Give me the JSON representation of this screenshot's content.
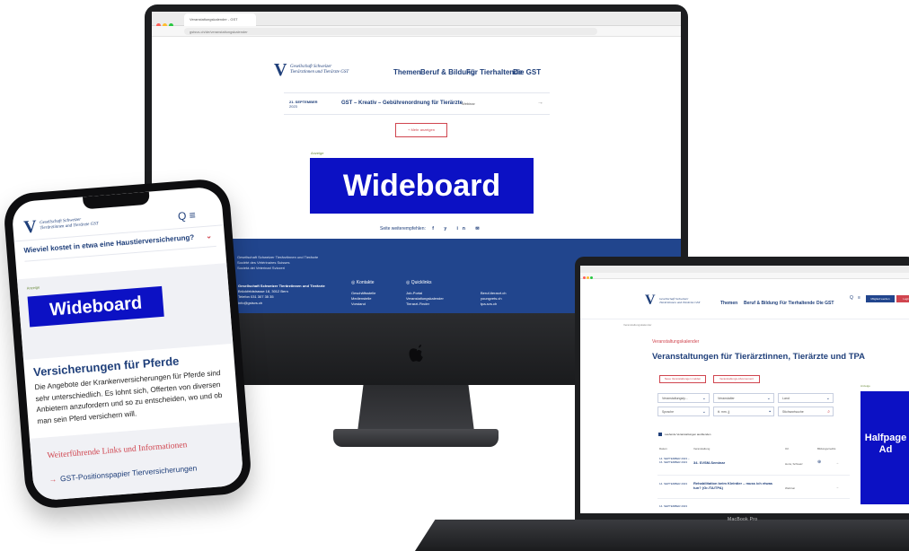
{
  "colors": {
    "brand": "#1f3f7a",
    "accent": "#d0454f",
    "ad": "#0c11c4",
    "footer": "#21458d"
  },
  "imac": {
    "browser": {
      "tab_title": "Veranstaltungskalender - GST",
      "url": "gstsvs.ch/de/veranstaltungskalender"
    },
    "logo": {
      "mark": "V",
      "line1": "Gesellschaft Schweizer",
      "line2": "Tierärztinnen und Tierärzte GST"
    },
    "nav": [
      "Themen",
      "Beruf & Bildung",
      "Für Tierhaltende",
      "Die GST"
    ],
    "event": {
      "date": "21. SEPTEMBER",
      "date_sub": "2023",
      "title": "GST – Kreativ – Gebührenordnung für Tierärzte",
      "type": "Webinar",
      "arrow": "→"
    },
    "more_button": "+ Mehr anzeigen",
    "ad_label": "Anzeige",
    "wideboard": "Wideboard",
    "share_label": "Seite weiterempfehlen:",
    "share_icons": "f y in ✉",
    "footer": {
      "logo_mark": "V",
      "text": [
        "Gesellschaft Schweizer Tierärztinnen und Tierärzte",
        "Société des Vétérinaires Suisses",
        "Società dei Veterinari Svizzeri"
      ],
      "address": {
        "heading": "Gesellschaft Schweizer Tierärztinnen und Tierärzte",
        "lines": [
          "Brückfeldstrasse 18, 3012 Bern",
          "Telefon 031 307 35 35",
          "info@gstsvs.ch"
        ]
      },
      "kontakte": {
        "heading": "◎ Kontakte",
        "items": [
          "Geschäftsstelle",
          "Medienstelle",
          "Vorstand"
        ]
      },
      "quicklinks": {
        "heading": "◎ Quicklinks",
        "items": [
          "Job-Portal",
          "Veranstaltungskalender",
          "Tierarzt-Finder"
        ]
      },
      "links": [
        "Beruf-tierarzt.ch",
        "youngvets.ch",
        "tpa-svs.ch"
      ]
    }
  },
  "phone": {
    "logo": {
      "mark": "V",
      "line1": "Gesellschaft Schweizer",
      "line2": "Tierärztinnen und Tierärzte GST"
    },
    "header_icons": "Q ≡",
    "faq": "Wieviel kostet in etwa eine Haustierversicherung?",
    "faq_chevron": "⌄",
    "ad_label": "Anzeige",
    "wideboard": "Wideboard",
    "heading": "Versicherungen für Pferde",
    "body": "Die Angebote der Krankenversicherungen für Pferde sind sehr unterschiedlich. Es lohnt sich, Offerten von diversen Anbietern anzufordern und so zu entscheiden, wo und ob man sein Pferd versichern will.",
    "links_title": "Weiterführende Links und Informationen",
    "link_arrow": "→",
    "link": "GST-Positionspapier Tierversicherungen"
  },
  "laptop": {
    "logo": {
      "mark": "V",
      "line1": "Gesellschaft Schweizer",
      "line2": "Tierärztinnen und Tierärzte GST"
    },
    "nav": [
      "Themen",
      "Beruf & Bildung",
      "Für Tierhaltende",
      "Die GST"
    ],
    "top_buttons": [
      "Mitglied werden",
      "Login"
    ],
    "breadcrumb": "Veranstaltungskalender",
    "kicker": "Veranstaltungskalender",
    "title": "Veranstaltungen für Tierärztinnen, Tierärzte und TPA",
    "buttons": [
      "Neue Veranstaltungen melden",
      "Veranstaltungs-Abonnement"
    ],
    "filters": {
      "type": "Veranstaltungsty...",
      "organizer": "Veranstalter",
      "place": "Land",
      "language": "Sprache",
      "date": "tt. mm. jj",
      "search": "Stichwortsuche"
    },
    "checkbox": "Laufende Veranstaltungen ausblenden",
    "columns": [
      "Datum",
      "Veranstaltung",
      "Ort",
      "Bildungscredits"
    ],
    "rows": [
      {
        "date": "14. SEPTEMBER 2023 – 16. SEPTEMBER 2023",
        "title": "34. SVSM-Seminar",
        "place": "Horw, Schweiz",
        "extra": "⊕",
        "arrow": "→"
      },
      {
        "date": "14. SEPTEMBER 2023",
        "title": "Rehabilitation beim Kleintier – muss ich etwas tun? (Gr./TA/TPA)",
        "place": "Webinar",
        "extra": "",
        "arrow": "→"
      },
      {
        "date": "14. SEPTEMBER 2023",
        "title": "",
        "place": "",
        "extra": "",
        "arrow": ""
      }
    ],
    "ad_label": "Anzeige",
    "halfpage": "Halfpage Ad",
    "brand": "MacBook Pro"
  }
}
